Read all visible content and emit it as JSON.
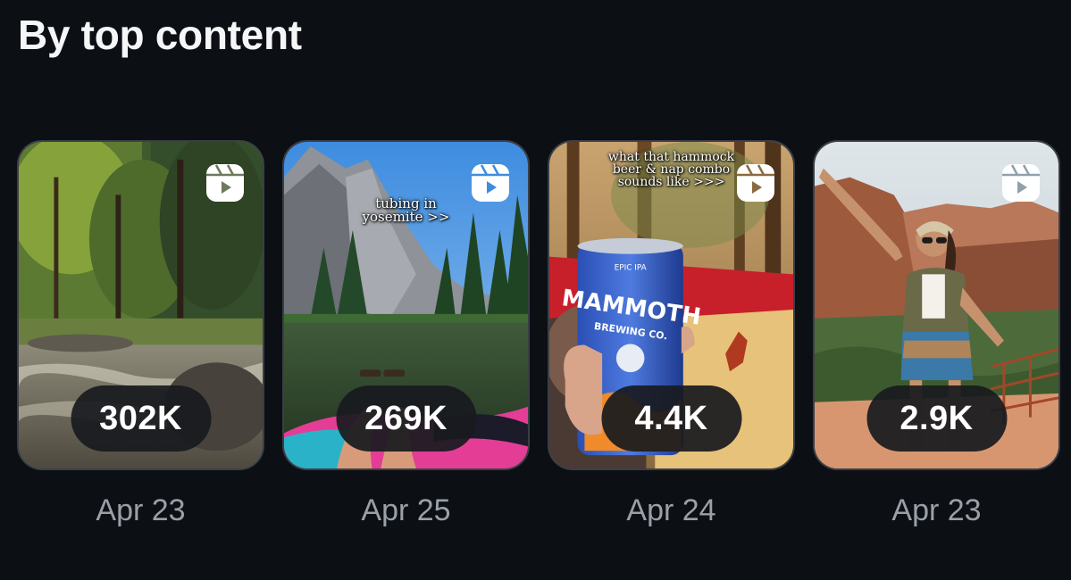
{
  "section_title": "By top content",
  "posts": [
    {
      "count": "302K",
      "date": "Apr 23",
      "overlay_lines": []
    },
    {
      "count": "269K",
      "date": "Apr 25",
      "overlay_lines": [
        "tubing in",
        "yosemite >>"
      ]
    },
    {
      "count": "4.4K",
      "date": "Apr 24",
      "overlay_lines": [
        "what that hammock",
        "beer & nap combo",
        "sounds like >>>"
      ],
      "can_text": [
        "EPIC IPA",
        "MAMMOTH",
        "BREWING CO."
      ]
    },
    {
      "count": "2.9K",
      "date": "Apr 23",
      "overlay_lines": []
    }
  ],
  "icons": {
    "reel": "reels-icon"
  }
}
